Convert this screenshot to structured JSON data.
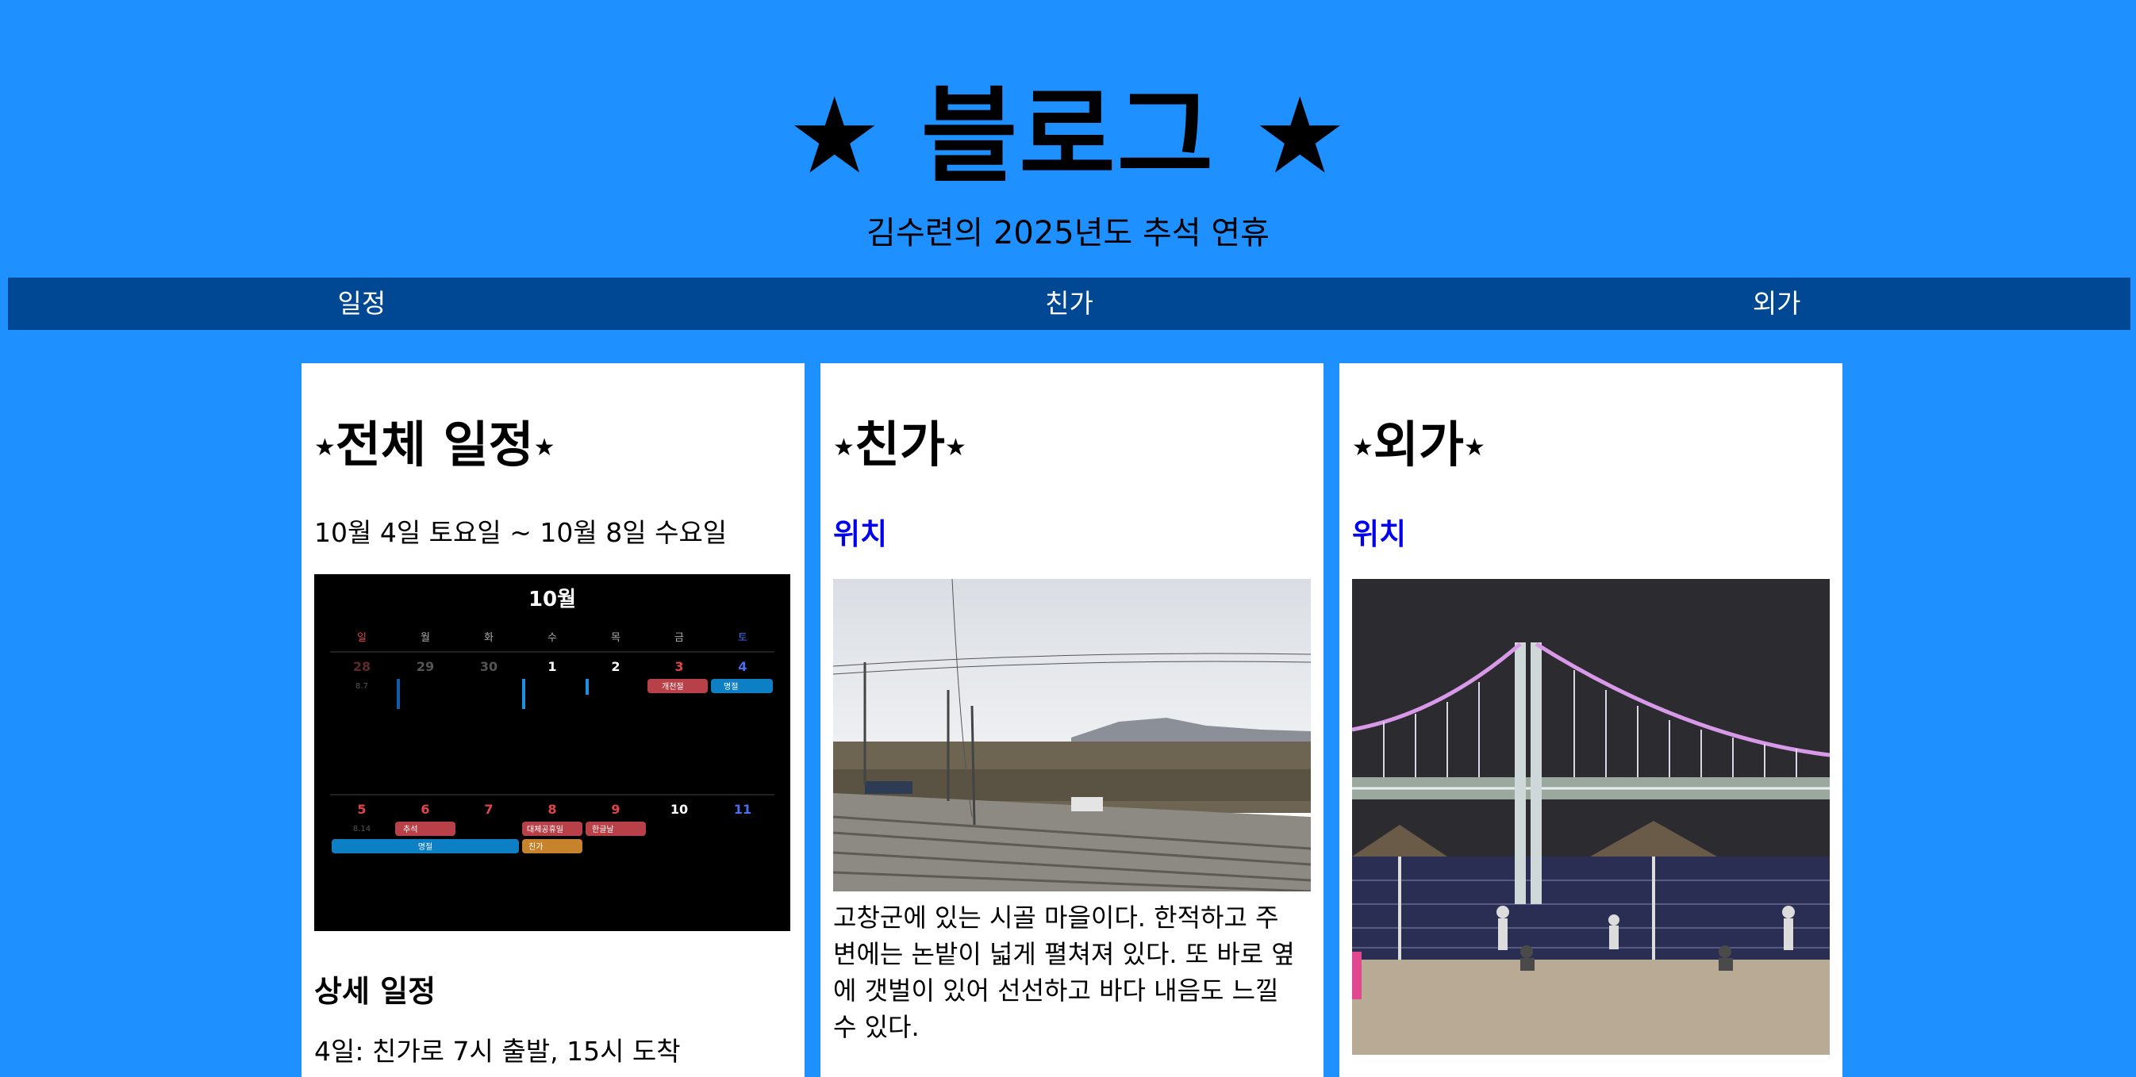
{
  "header": {
    "title": "★ 블로그 ★",
    "subtitle": "김수련의 2025년도 추석 연휴"
  },
  "nav": {
    "items": [
      "일정",
      "친가",
      "외가"
    ]
  },
  "cards": {
    "schedule": {
      "star": "★",
      "title": "전체 일정",
      "date_range": "10월 4일 토요일 ~ 10월 8일 수요일",
      "section_title": "상세 일정",
      "detail_1": "4일: 친가로 7시 출발, 15시 도착"
    },
    "paternal": {
      "star": "★",
      "title": "친가",
      "location_link": "위치",
      "description": "고창군에 있는 시골 마을이다. 한적하고 주변에는 논밭이 넓게 펼쳐져 있다. 또 바로 옆에 갯벌이 있어 선선하고 바다 내음도 느낄 수 있다."
    },
    "maternal": {
      "star": "★",
      "title": "외가",
      "location_link": "위치"
    }
  },
  "calendar": {
    "month": "10월",
    "weekdays": [
      "일",
      "월",
      "화",
      "수",
      "목",
      "금",
      "토"
    ],
    "week1": [
      "28",
      "29",
      "30",
      "1",
      "2",
      "3",
      "4"
    ],
    "week2": [
      "5",
      "6",
      "7",
      "8",
      "9",
      "10",
      "11"
    ],
    "sub_w1": "8.7",
    "sub_w2": "8.14",
    "events": {
      "gaecheonjeol": "개천절",
      "myeongjeol1": "명절",
      "chuseok": "추석",
      "daeche": "대체공휴일",
      "hangeul": "한글날",
      "myeongjeol2": "명절",
      "chingga": "친가"
    }
  },
  "colors": {
    "background": "#1e90ff",
    "nav": "#004894",
    "link": "#0000ee"
  }
}
